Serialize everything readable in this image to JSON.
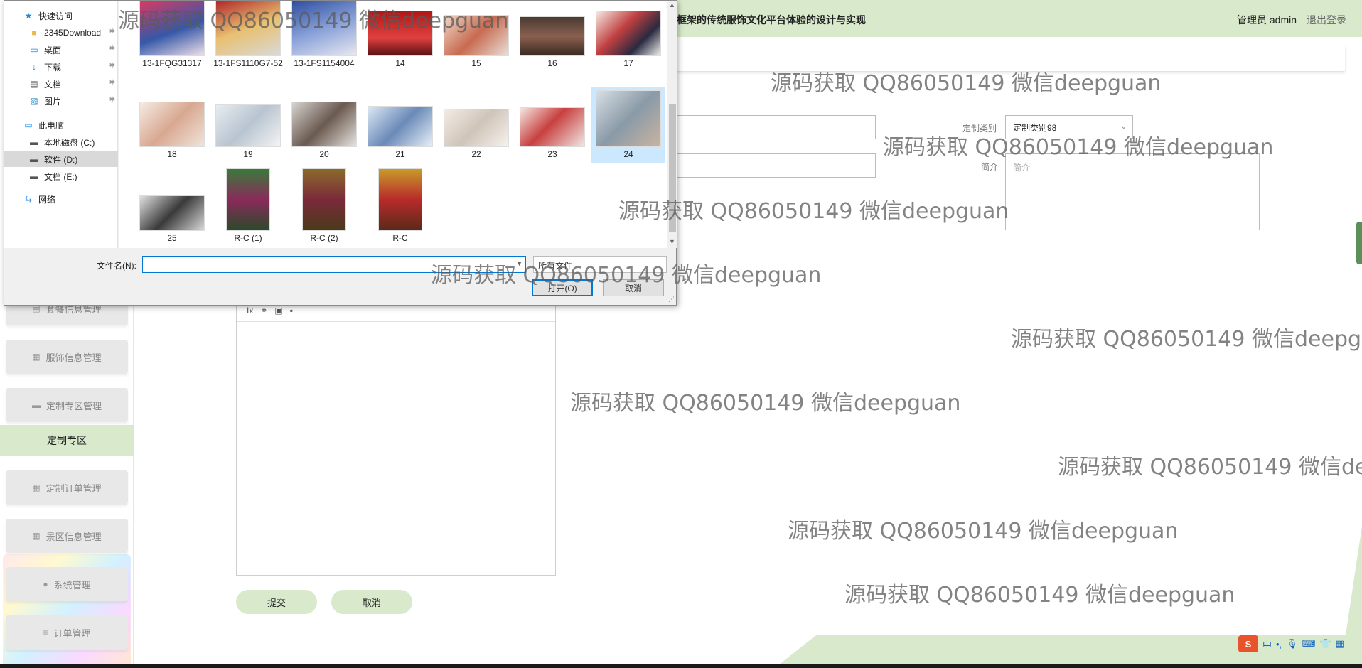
{
  "app": {
    "title": "框架的传统服饰文化平台体验的设计与实现",
    "admin_label": "管理员 admin",
    "logout_label": "退出登录"
  },
  "sidebar": {
    "items": [
      {
        "label": "套餐信息管理",
        "icon": "document-icon"
      },
      {
        "label": "服饰信息管理",
        "icon": "grid-icon"
      },
      {
        "label": "定制专区管理",
        "icon": "monitor-icon"
      },
      {
        "label": "定制专区",
        "icon": ""
      },
      {
        "label": "定制订单管理",
        "icon": "grid-icon"
      },
      {
        "label": "景区信息管理",
        "icon": "grid-icon"
      },
      {
        "label": "系统管理",
        "icon": "location-icon"
      },
      {
        "label": "订单管理",
        "icon": "list-icon"
      }
    ]
  },
  "form": {
    "category_label": "定制类别",
    "category_value": "定制类别98",
    "intro_label": "简介",
    "intro_placeholder": "简介",
    "submit_label": "提交",
    "cancel_label": "取消"
  },
  "dialog": {
    "nav": [
      {
        "label": "快速访问",
        "icon": "star-icon"
      },
      {
        "label": "2345Download",
        "icon": "folder-icon"
      },
      {
        "label": "桌面",
        "icon": "desktop-icon"
      },
      {
        "label": "下载",
        "icon": "download-icon"
      },
      {
        "label": "文档",
        "icon": "document-icon"
      },
      {
        "label": "图片",
        "icon": "picture-icon"
      },
      {
        "label": "此电脑",
        "icon": "computer-icon"
      },
      {
        "label": "本地磁盘 (C:)",
        "icon": "drive-icon"
      },
      {
        "label": "软件 (D:)",
        "icon": "drive-icon"
      },
      {
        "label": "文档 (E:)",
        "icon": "drive-icon"
      },
      {
        "label": "网络",
        "icon": "network-icon"
      }
    ],
    "files_row1": [
      "13-1FQG31317",
      "13-1FS1110G7-52",
      "13-1FS1154004",
      "14",
      "15",
      "16",
      "17"
    ],
    "files_row2": [
      "18",
      "19",
      "20",
      "21",
      "22",
      "23",
      "24"
    ],
    "files_row3": [
      "25",
      "R-C (1)",
      "R-C (2)",
      "R-C"
    ],
    "filename_label": "文件名(N):",
    "filename_value": "",
    "filetype_label": "所有文件",
    "open_label": "打开(O)",
    "cancel_label": "取消"
  },
  "watermark": "源码获取 QQ86050149 微信deepguan",
  "tray": {
    "ime_logo": "S",
    "ime_mode": "中"
  }
}
